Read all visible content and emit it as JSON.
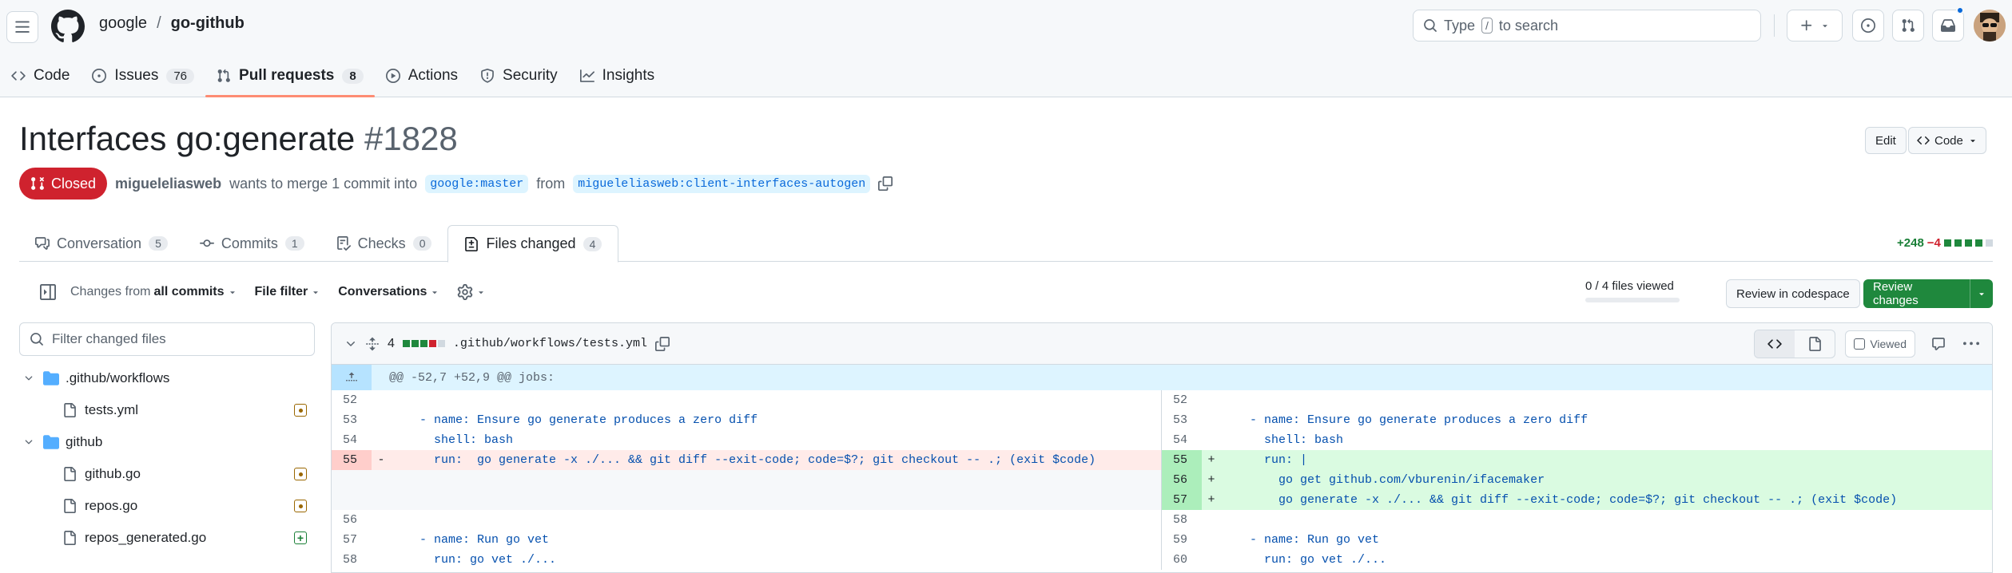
{
  "header": {
    "owner": "google",
    "separator": "/",
    "repo": "go-github",
    "search_prefix": "Type",
    "search_key": "/",
    "search_suffix": "to search"
  },
  "repo_nav": [
    {
      "label": "Code",
      "icon": "code-icon"
    },
    {
      "label": "Issues",
      "icon": "issue-opened-icon",
      "count": "76"
    },
    {
      "label": "Pull requests",
      "icon": "git-pull-request-icon",
      "count": "8",
      "selected": true
    },
    {
      "label": "Actions",
      "icon": "play-icon"
    },
    {
      "label": "Security",
      "icon": "shield-icon"
    },
    {
      "label": "Insights",
      "icon": "graph-icon"
    }
  ],
  "pr": {
    "title": "Interfaces go:generate",
    "number": "#1828",
    "edit_label": "Edit",
    "code_label": "Code",
    "state": "Closed",
    "author": "migueleliasweb",
    "merge_text": "wants to merge 1 commit into",
    "base": "google:master",
    "from_text": "from",
    "head": "migueleliasweb:client-interfaces-autogen"
  },
  "pr_tabs": [
    {
      "label": "Conversation",
      "count": "5",
      "icon": "comment-discussion-icon"
    },
    {
      "label": "Commits",
      "count": "1",
      "icon": "git-commit-icon"
    },
    {
      "label": "Checks",
      "count": "0",
      "icon": "checklist-icon"
    },
    {
      "label": "Files changed",
      "count": "4",
      "icon": "file-diff-icon",
      "active": true
    }
  ],
  "diffstat": {
    "additions": "+248",
    "deletions": "−4"
  },
  "toolbar": {
    "changes_from_prefix": "Changes from",
    "changes_from_value": "all commits",
    "file_filter": "File filter",
    "conversations": "Conversations",
    "files_viewed": "0 / 4 files viewed",
    "codespace": "Review in codespace",
    "review": "Review changes"
  },
  "file_tree": {
    "filter_placeholder": "Filter changed files",
    "items": [
      {
        "type": "dir",
        "name": ".github/workflows"
      },
      {
        "type": "file",
        "name": "tests.yml",
        "status": "modified"
      },
      {
        "type": "dir",
        "name": "github"
      },
      {
        "type": "file",
        "name": "github.go",
        "status": "modified"
      },
      {
        "type": "file",
        "name": "repos.go",
        "status": "modified"
      },
      {
        "type": "file",
        "name": "repos_generated.go",
        "status": "added"
      }
    ]
  },
  "diff": {
    "changes": "4",
    "filename": ".github/workflows/tests.yml",
    "viewed_label": "Viewed",
    "hunk": "@@ -52,7 +52,9 @@ jobs:",
    "left": [
      {
        "ln": "52",
        "mk": "",
        "code": "",
        "type": "ctx"
      },
      {
        "ln": "53",
        "mk": "",
        "code": "    - name: Ensure go generate produces a zero diff",
        "type": "ctx"
      },
      {
        "ln": "54",
        "mk": "",
        "code": "      shell: bash",
        "type": "ctx"
      },
      {
        "ln": "55",
        "mk": "-",
        "code": "      run:  go generate -x ./... && git diff --exit-code; code=$?; git checkout -- .; (exit $code)",
        "type": "del"
      },
      {
        "ln": "",
        "mk": "",
        "code": "",
        "type": "empty"
      },
      {
        "ln": "",
        "mk": "",
        "code": "",
        "type": "empty"
      },
      {
        "ln": "56",
        "mk": "",
        "code": "",
        "type": "ctx"
      },
      {
        "ln": "57",
        "mk": "",
        "code": "    - name: Run go vet",
        "type": "ctx"
      },
      {
        "ln": "58",
        "mk": "",
        "code": "      run: go vet ./...",
        "type": "ctx"
      }
    ],
    "right": [
      {
        "ln": "52",
        "mk": "",
        "code": "",
        "type": "ctx"
      },
      {
        "ln": "53",
        "mk": "",
        "code": "    - name: Ensure go generate produces a zero diff",
        "type": "ctx"
      },
      {
        "ln": "54",
        "mk": "",
        "code": "      shell: bash",
        "type": "ctx"
      },
      {
        "ln": "55",
        "mk": "+",
        "code": "      run: |",
        "type": "add"
      },
      {
        "ln": "56",
        "mk": "+",
        "code": "        go get github.com/vburenin/ifacemaker",
        "type": "add"
      },
      {
        "ln": "57",
        "mk": "+",
        "code": "        go generate -x ./... && git diff --exit-code; code=$?; git checkout -- .; (exit $code)",
        "type": "add"
      },
      {
        "ln": "58",
        "mk": "",
        "code": "",
        "type": "ctx"
      },
      {
        "ln": "59",
        "mk": "",
        "code": "    - name: Run go vet",
        "type": "ctx"
      },
      {
        "ln": "60",
        "mk": "",
        "code": "      run: go vet ./...",
        "type": "ctx"
      }
    ]
  },
  "colors": {
    "accent": "#0969da",
    "closed": "#cf222e",
    "review": "#1f883d",
    "tab_underline": "#fd8c73"
  }
}
